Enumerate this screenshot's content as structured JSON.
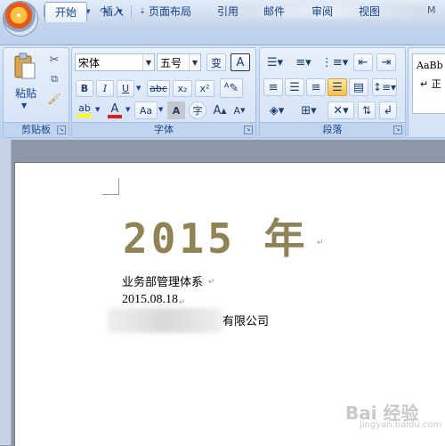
{
  "qat": {
    "save": "💾",
    "undo": "↶",
    "redo": "↷"
  },
  "title_tail": "M",
  "tabs": [
    {
      "label": "开始",
      "active": true
    },
    {
      "label": "插入"
    },
    {
      "label": "页面布局"
    },
    {
      "label": "引用"
    },
    {
      "label": "邮件"
    },
    {
      "label": "审阅"
    },
    {
      "label": "视图"
    }
  ],
  "clipboard": {
    "group_label": "剪贴板",
    "paste_label": "粘贴"
  },
  "font": {
    "group_label": "字体",
    "font_name": "宋体",
    "font_size": "五号",
    "bold": "B",
    "italic": "I",
    "underline": "U",
    "strikethrough": "abc",
    "subscript": "x₂",
    "superscript": "x²",
    "change_case": "Aa",
    "char_border": "A",
    "enclose": "字",
    "grow": "A",
    "shrink": "A",
    "phonetic": "变",
    "font_color_letter": "A"
  },
  "paragraph": {
    "group_label": "段落"
  },
  "styles": {
    "sample": "AaBb",
    "name": "↵ 正"
  },
  "document": {
    "heading": "2015 年",
    "line1": "业务部管理体系",
    "line2": "2015.08.18",
    "line3": "有限公司",
    "para_mark": "↵"
  },
  "watermark": {
    "main": "Bai 经验",
    "sub": "jingyan.baidu.com"
  },
  "colors": {
    "highlight": "#ffff00",
    "font_color": "#e02020",
    "heading": "#8f8254"
  }
}
